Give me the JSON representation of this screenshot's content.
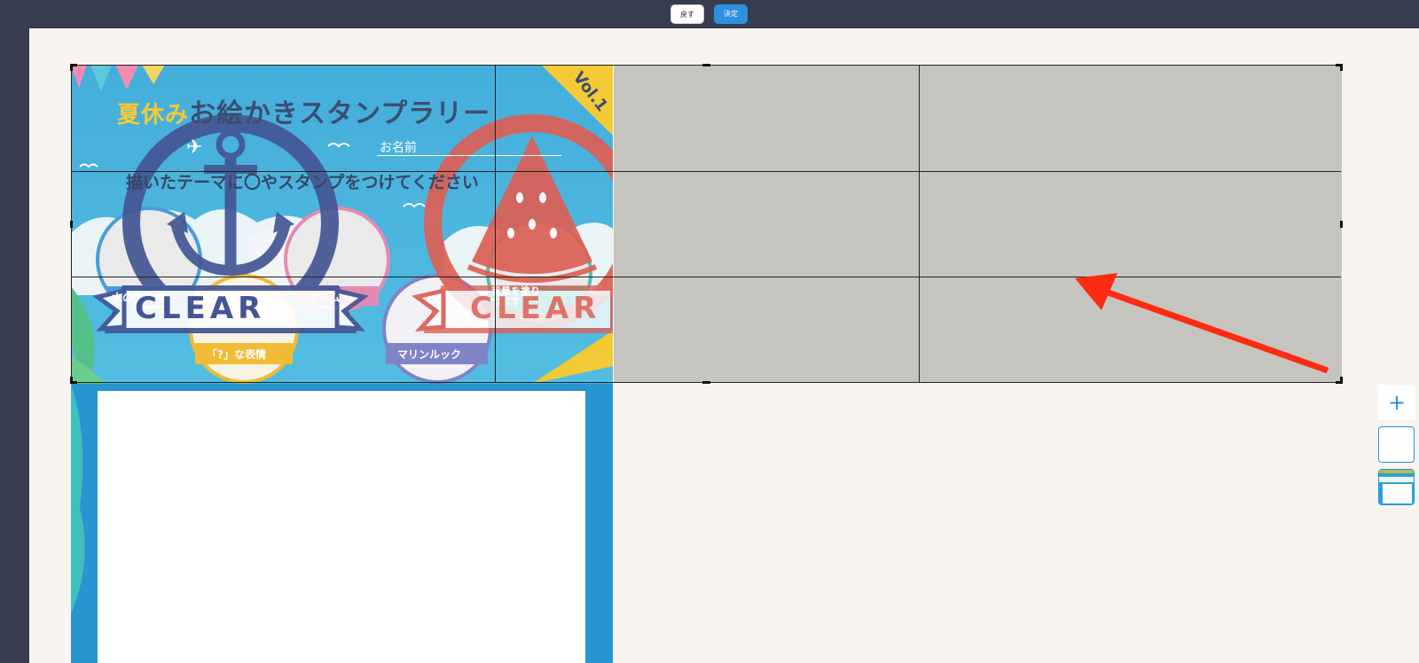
{
  "toolbar": {
    "back_label": "戻す",
    "confirm_label": "決定"
  },
  "poster": {
    "title_prefix": "夏休み",
    "title_main": "お絵かきスタンプラリー",
    "vol": "Vol.1",
    "name_label": "お名前",
    "instruction": "描いたテーマに〇やスタンプをつけてください",
    "circles": [
      {
        "label": "水の生き物",
        "color": "#2f8fd8"
      },
      {
        "label": "ゲーム",
        "color": "#e279a8"
      },
      {
        "label": "背景を塗りつぶす",
        "color": "#3ab7a7"
      },
      {
        "label": "「?」な表情",
        "color": "#f0b21a"
      },
      {
        "label": "マリンルック",
        "color": "#6e73c0"
      }
    ],
    "stamps": [
      {
        "text": "CLEAR",
        "icon": "anchor-icon",
        "color": "#2a3f86"
      },
      {
        "text": "CLEAR",
        "icon": "watermelon-icon",
        "color": "#d84a3d"
      }
    ]
  },
  "side_panel": {
    "add_label": "+"
  },
  "colors": {
    "accent": "#2e8fe0",
    "background": "#373d4f",
    "workspace": "#f8f4f0",
    "crop_dim": "#c6c4be",
    "arrow": "#ff2a12"
  }
}
